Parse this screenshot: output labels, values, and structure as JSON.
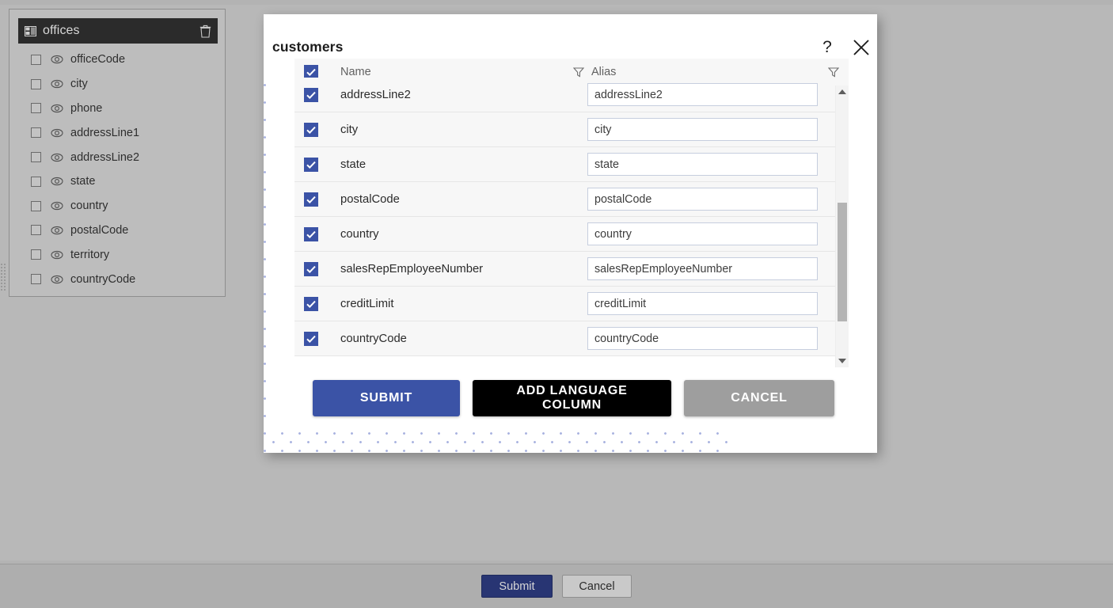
{
  "sidebar": {
    "header": {
      "title": "offices",
      "table_icon": "table-icon",
      "delete_icon": "trash-icon"
    },
    "fields": [
      {
        "name": "officeCode",
        "checked": false,
        "visibility_icon": "eye-icon"
      },
      {
        "name": "city",
        "checked": false,
        "visibility_icon": "eye-icon"
      },
      {
        "name": "phone",
        "checked": false,
        "visibility_icon": "eye-icon"
      },
      {
        "name": "addressLine1",
        "checked": false,
        "visibility_icon": "eye-icon"
      },
      {
        "name": "addressLine2",
        "checked": false,
        "visibility_icon": "eye-icon"
      },
      {
        "name": "state",
        "checked": false,
        "visibility_icon": "eye-icon"
      },
      {
        "name": "country",
        "checked": false,
        "visibility_icon": "eye-icon"
      },
      {
        "name": "postalCode",
        "checked": false,
        "visibility_icon": "eye-icon"
      },
      {
        "name": "territory",
        "checked": false,
        "visibility_icon": "eye-icon"
      },
      {
        "name": "countryCode",
        "checked": false,
        "visibility_icon": "eye-icon"
      }
    ]
  },
  "modal": {
    "title": "customers",
    "help_label": "?",
    "close_icon": "close-icon",
    "table": {
      "select_all_checked": true,
      "columns": [
        {
          "label": "Name",
          "filter_icon": "filter-funnel-icon"
        },
        {
          "label": "Alias",
          "filter_icon": "filter-funnel-icon"
        }
      ],
      "rows": [
        {
          "checked": true,
          "name": "addressLine2",
          "alias": "addressLine2"
        },
        {
          "checked": true,
          "name": "city",
          "alias": "city"
        },
        {
          "checked": true,
          "name": "state",
          "alias": "state"
        },
        {
          "checked": true,
          "name": "postalCode",
          "alias": "postalCode"
        },
        {
          "checked": true,
          "name": "country",
          "alias": "country"
        },
        {
          "checked": true,
          "name": "salesRepEmployeeNumber",
          "alias": "salesRepEmployeeNumber"
        },
        {
          "checked": true,
          "name": "creditLimit",
          "alias": "creditLimit"
        },
        {
          "checked": true,
          "name": "countryCode",
          "alias": "countryCode"
        }
      ],
      "scrollbar": {
        "up_icon": "scroll-up-arrow-icon",
        "down_icon": "scroll-down-arrow-icon"
      }
    },
    "actions": {
      "submit": "SUBMIT",
      "add_language_column": "ADD LANGUAGE COLUMN",
      "cancel": "CANCEL"
    }
  },
  "bottom_bar": {
    "submit": "Submit",
    "cancel": "Cancel"
  },
  "colors": {
    "accent_blue": "#3b53a6",
    "black_button": "#000000",
    "gray_button": "#9e9e9e",
    "bottom_submit": "#283573",
    "page_background": "#b3b3b3",
    "sidebar_header": "#2b2b2b",
    "dot_pattern": "#aab4e0"
  }
}
